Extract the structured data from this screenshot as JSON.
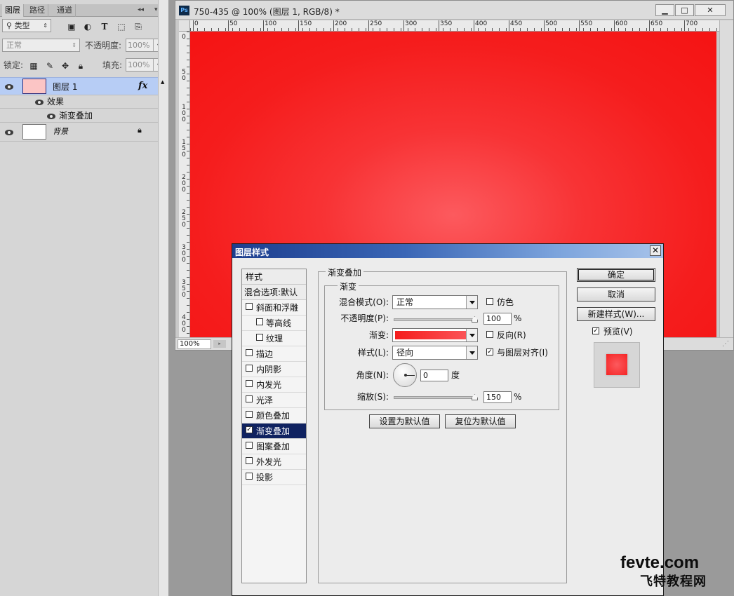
{
  "layers_panel": {
    "tabs": [
      "图层",
      "路径",
      "通道"
    ],
    "tab_controls": {
      "collapse": "◂◂",
      "menu": "▾≡"
    },
    "filter_label": "类型",
    "blend_mode": "正常",
    "opacity_label": "不透明度:",
    "opacity_value": "100%",
    "lock_label": "锁定:",
    "fill_label": "填充:",
    "fill_value": "100%",
    "layers": [
      {
        "name": "图层 1",
        "fx": "fx",
        "effects_label": "效果",
        "effect_name": "渐变叠加"
      },
      {
        "name": "背景"
      }
    ]
  },
  "document": {
    "app_icon": "Ps",
    "title": "750-435 @ 100% (图层 1, RGB/8) *",
    "window_buttons": {
      "minimize": "▁",
      "maximize": "□",
      "close": "✕"
    },
    "ruler_h_labels": [
      "0",
      "50",
      "100",
      "150",
      "200",
      "250",
      "300",
      "350",
      "400",
      "450",
      "500",
      "550",
      "600",
      "650",
      "700"
    ],
    "ruler_v_labels": [
      "0",
      "50",
      "100",
      "150",
      "200",
      "250",
      "300",
      "350",
      "400"
    ],
    "zoom": "100%",
    "status_arrow": "▸"
  },
  "dialog": {
    "title": "图层样式",
    "close": "✕",
    "styles_header": "样式",
    "blend_options": "混合选项:默认",
    "style_items": [
      {
        "label": "斜面和浮雕",
        "checked": false,
        "sub": false
      },
      {
        "label": "等高线",
        "checked": false,
        "sub": true
      },
      {
        "label": "纹理",
        "checked": false,
        "sub": true
      },
      {
        "label": "描边",
        "checked": false,
        "sub": false
      },
      {
        "label": "内阴影",
        "checked": false,
        "sub": false
      },
      {
        "label": "内发光",
        "checked": false,
        "sub": false
      },
      {
        "label": "光泽",
        "checked": false,
        "sub": false
      },
      {
        "label": "颜色叠加",
        "checked": false,
        "sub": false
      },
      {
        "label": "渐变叠加",
        "checked": true,
        "sub": false,
        "selected": true
      },
      {
        "label": "图案叠加",
        "checked": false,
        "sub": false
      },
      {
        "label": "外发光",
        "checked": false,
        "sub": false
      },
      {
        "label": "投影",
        "checked": false,
        "sub": false
      }
    ],
    "group_title": "渐变叠加",
    "subgroup_title": "渐变",
    "blend_mode_label": "混合模式(O):",
    "blend_mode_value": "正常",
    "dither_label": "仿色",
    "opacity_label": "不透明度(P):",
    "opacity_value": "100",
    "opacity_percent": 100,
    "gradient_label": "渐变:",
    "reverse_label": "反向(R)",
    "style_label": "样式(L):",
    "style_value": "径向",
    "align_label": "与图层对齐(I)",
    "angle_label": "角度(N):",
    "angle_value": "0",
    "angle_unit": "度",
    "scale_label": "缩放(S):",
    "scale_value": "150",
    "scale_percent": 150,
    "percent_sign": "%",
    "set_default": "设置为默认值",
    "reset_default": "复位为默认值",
    "ok": "确定",
    "cancel": "取消",
    "new_style": "新建样式(W)...",
    "preview_label": "预览(V)",
    "check_mark": "✓"
  },
  "watermark": {
    "line1": "fevte.com",
    "line2": "飞特教程网"
  },
  "colors": {
    "canvas_red": "#f51d1d",
    "canvas_center": "#fc5a5e",
    "dialog_title_start": "#1d3e8e",
    "selected_item": "#0f2260"
  }
}
